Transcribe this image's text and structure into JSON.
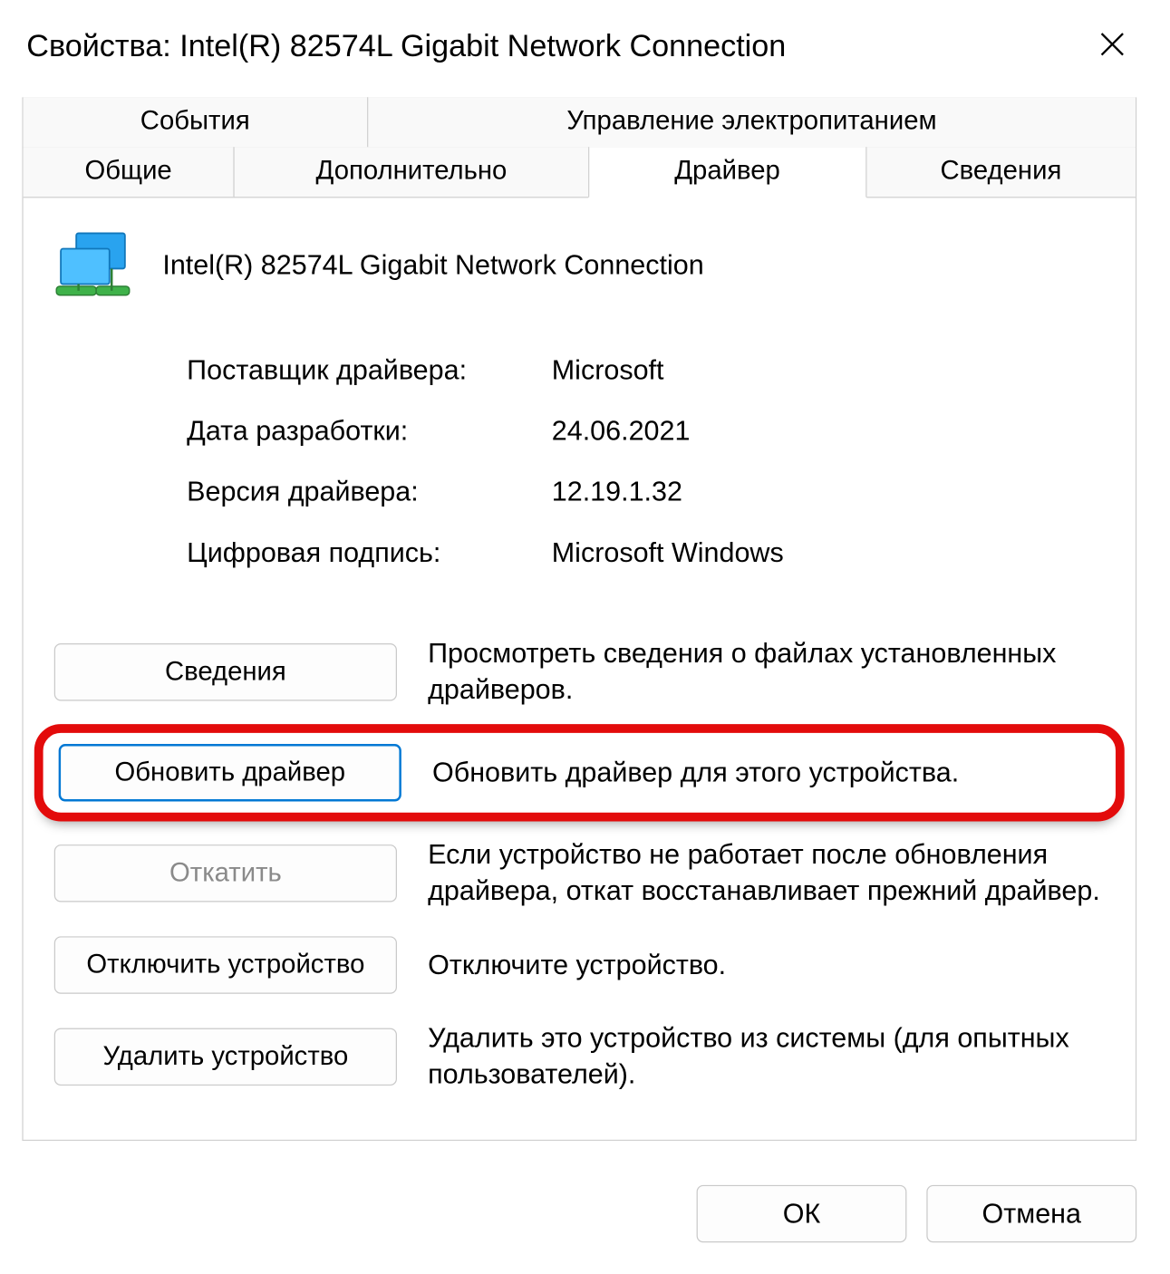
{
  "window": {
    "title": "Свойства: Intel(R) 82574L Gigabit Network Connection"
  },
  "tabs": {
    "row1": [
      {
        "id": "events",
        "label": "События"
      },
      {
        "id": "power",
        "label": "Управление электропитанием"
      }
    ],
    "row2": [
      {
        "id": "general",
        "label": "Общие"
      },
      {
        "id": "advanced",
        "label": "Дополнительно"
      },
      {
        "id": "driver",
        "label": "Драйвер",
        "active": true
      },
      {
        "id": "details",
        "label": "Сведения"
      }
    ]
  },
  "device": {
    "name": "Intel(R) 82574L Gigabit Network Connection",
    "icon": "network-adapter-icon"
  },
  "info": {
    "provider_label": "Поставщик драйвера:",
    "provider_value": "Microsoft",
    "date_label": "Дата разработки:",
    "date_value": "24.06.2021",
    "version_label": "Версия драйвера:",
    "version_value": "12.19.1.32",
    "signer_label": "Цифровая подпись:",
    "signer_value": "Microsoft Windows"
  },
  "actions": {
    "details": {
      "button": "Сведения",
      "desc": "Просмотреть сведения о файлах установленных драйверов."
    },
    "update": {
      "button": "Обновить драйвер",
      "desc": "Обновить драйвер для этого устройства."
    },
    "rollback": {
      "button": "Откатить",
      "desc": "Если устройство не работает после обновления драйвера, откат восстанавливает прежний драйвер."
    },
    "disable": {
      "button": "Отключить устройство",
      "desc": "Отключите устройство."
    },
    "uninstall": {
      "button": "Удалить устройство",
      "desc": "Удалить это устройство из системы (для опытных пользователей)."
    }
  },
  "footer": {
    "ok": "ОК",
    "cancel": "Отмена"
  },
  "annotation": {
    "highlight": "update",
    "highlight_color": "#e30b0b"
  }
}
